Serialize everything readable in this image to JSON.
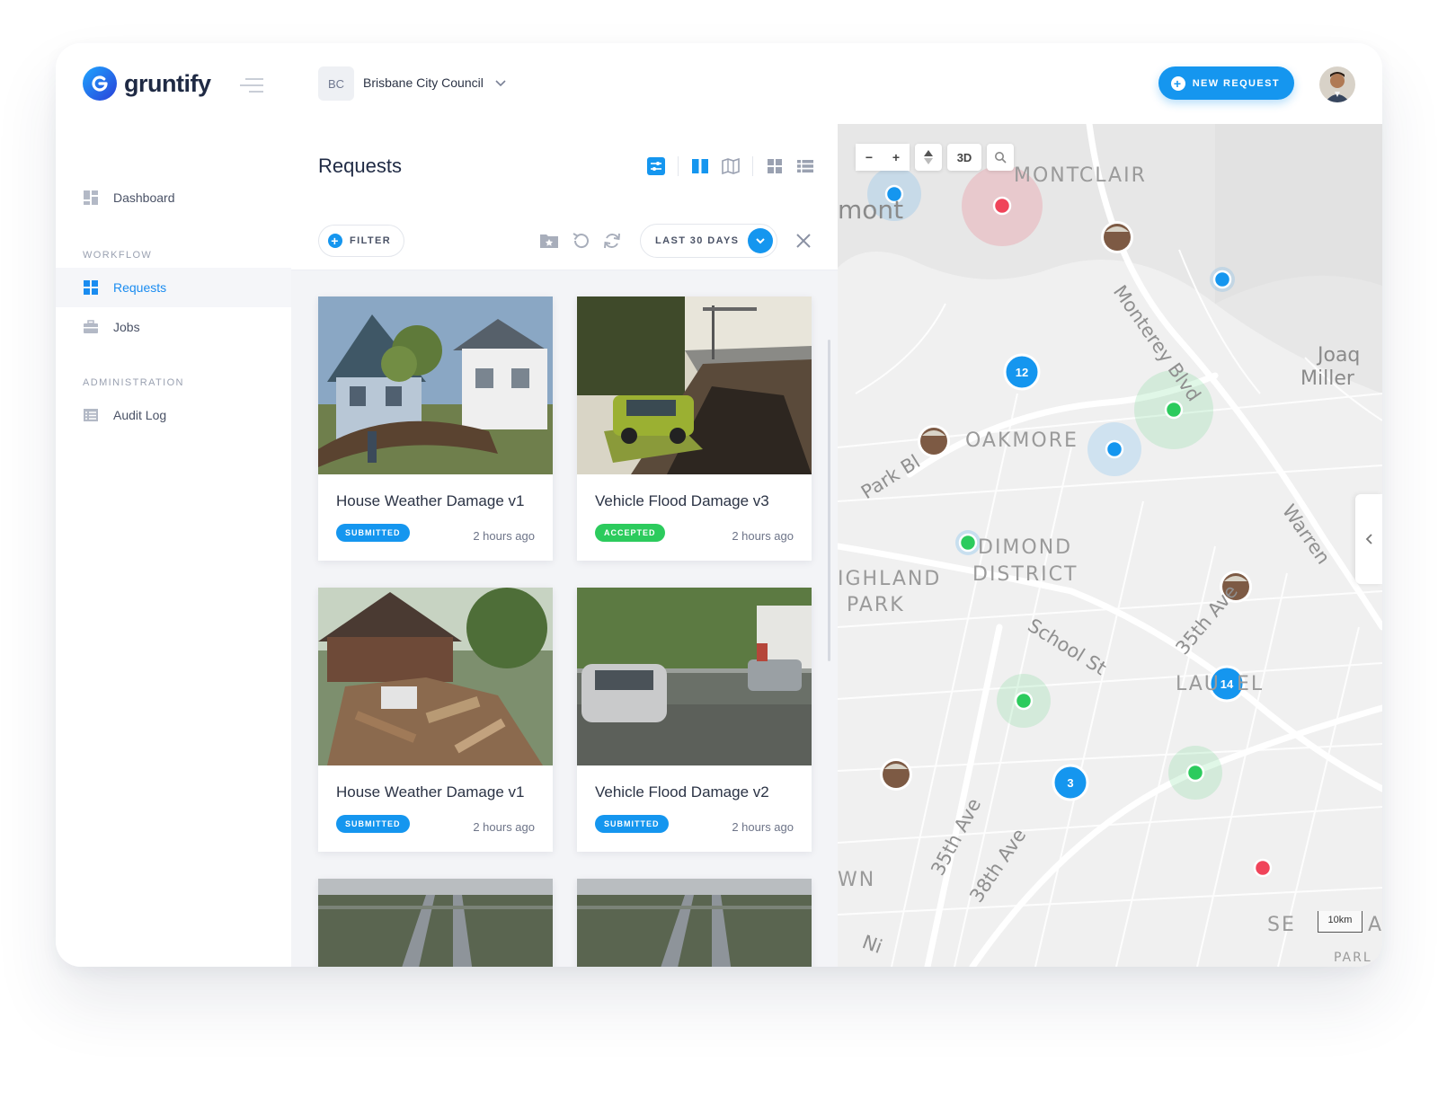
{
  "brand": {
    "name": "gruntify"
  },
  "sidebar": {
    "items": [
      {
        "label": "Dashboard",
        "icon": "dashboard-icon"
      },
      {
        "section": "WORKFLOW"
      },
      {
        "label": "Requests",
        "icon": "grid-icon",
        "active": true
      },
      {
        "label": "Jobs",
        "icon": "briefcase-icon"
      },
      {
        "section": "ADMINISTRATION"
      },
      {
        "label": "Audit Log",
        "icon": "list-icon"
      }
    ]
  },
  "header": {
    "org_initials": "BC",
    "org_name": "Brisbane City Council",
    "new_request_label": "NEW REQUEST"
  },
  "requests": {
    "title": "Requests",
    "filter_label": "FILTER",
    "range_label": "LAST 30 DAYS",
    "cards": [
      {
        "title": "House Weather Damage v1",
        "status": "SUBMITTED",
        "time": "2 hours ago"
      },
      {
        "title": "Vehicle Flood Damage v3",
        "status": "ACCEPTED",
        "time": "2 hours ago"
      },
      {
        "title": "House Weather Damage v1",
        "status": "SUBMITTED",
        "time": "2 hours ago"
      },
      {
        "title": "Vehicle Flood Damage v2",
        "status": "SUBMITTED",
        "time": "2 hours ago"
      }
    ]
  },
  "map": {
    "controls": {
      "zoom_out": "−",
      "zoom_in": "+",
      "mode_3d": "3D"
    },
    "labels": {
      "montclair": "MONTCLAIR",
      "mont": "mont",
      "oakmore": "OAKMORE",
      "dimond": "DIMOND",
      "district": "DISTRICT",
      "highland": "IGHLAND",
      "park": "PARK",
      "laurel_a": "LAU",
      "laurel_b": "EL",
      "joaquin": "Joaq",
      "miller": "Miller",
      "monterey": "Monterey Blvd",
      "parkblvd": "Park Bl",
      "warren": "Warren",
      "school": "School St",
      "ave35_a": "35th Ave",
      "ave35_b": "35th Ave",
      "ave38": "38th Ave",
      "wn": "WN",
      "se": "SE",
      "a": "A",
      "ni": "Ni",
      "parl": "PARL"
    },
    "clusters": [
      "12",
      "14",
      "3"
    ],
    "scale_label": "10km"
  },
  "colors": {
    "accent": "#1596ef",
    "accepted": "#2ccb5d",
    "alert": "#f0445a"
  }
}
